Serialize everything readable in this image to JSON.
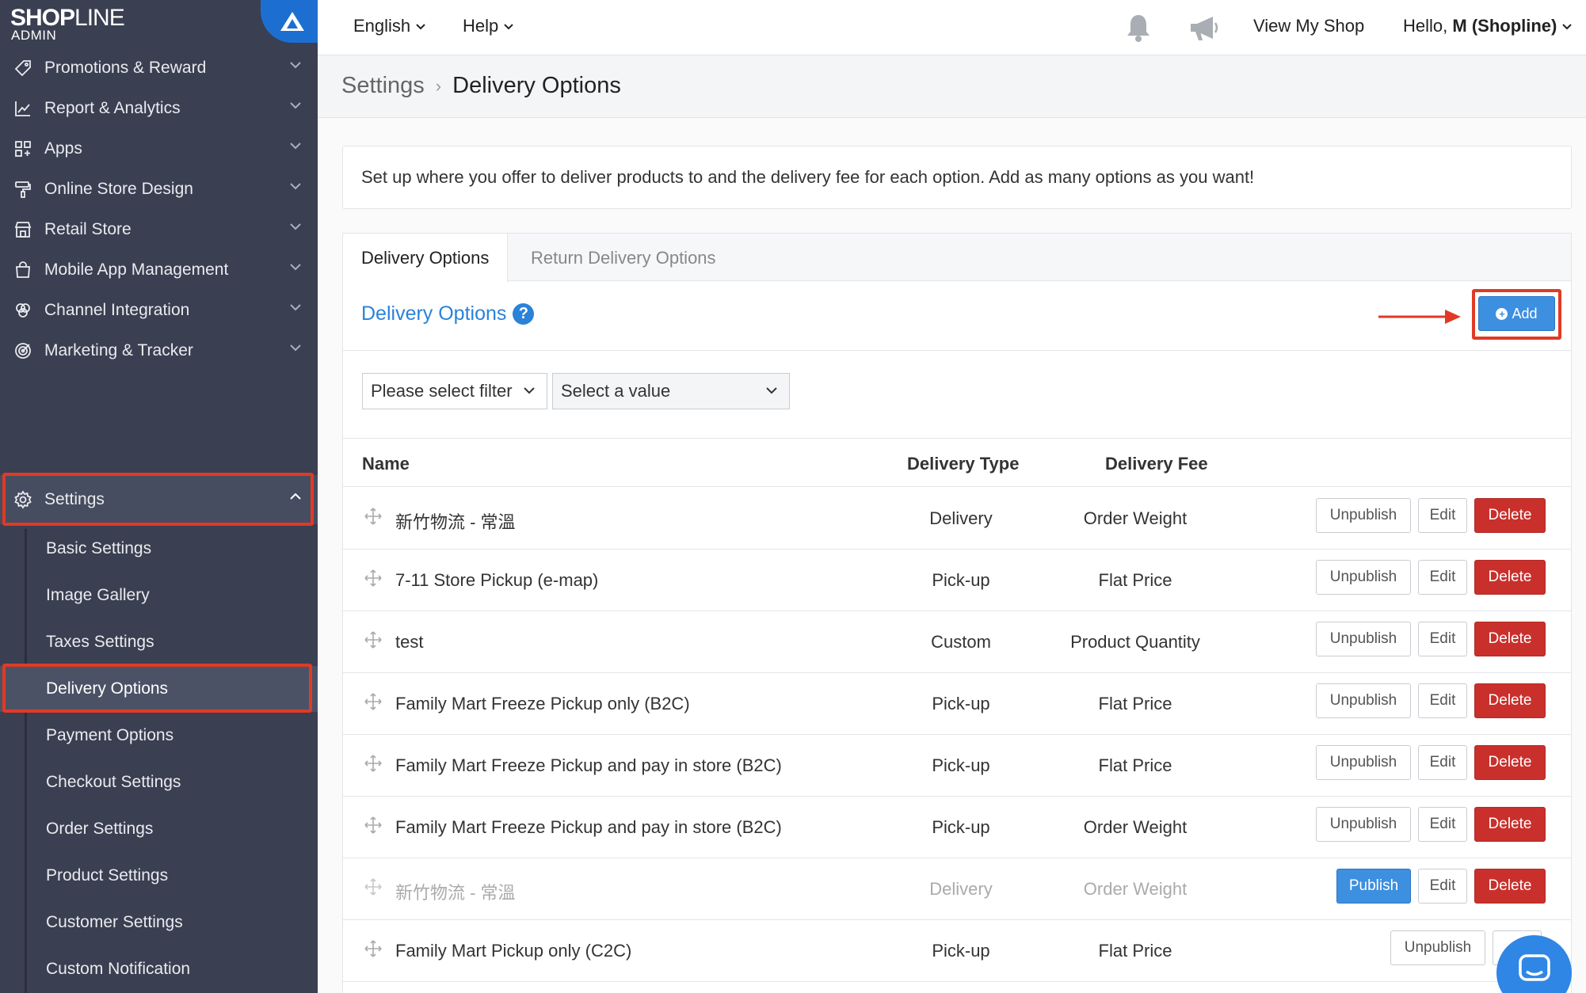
{
  "brand": {
    "logo_main": "SHOP",
    "logo_thin": "LINE",
    "logo_sub": "ADMIN"
  },
  "sidebar": {
    "items": [
      {
        "label": "Promotions & Reward",
        "icon": "tag-icon"
      },
      {
        "label": "Report & Analytics",
        "icon": "chart-icon"
      },
      {
        "label": "Apps",
        "icon": "apps-grid-icon"
      },
      {
        "label": "Online Store Design",
        "icon": "paint-roller-icon"
      },
      {
        "label": "Retail Store",
        "icon": "store-icon"
      },
      {
        "label": "Mobile App Management",
        "icon": "shopping-bag-icon"
      },
      {
        "label": "Channel Integration",
        "icon": "channels-icon"
      },
      {
        "label": "Marketing & Tracker",
        "icon": "target-icon"
      },
      {
        "label": "Settings",
        "icon": "gear-icon",
        "expanded": true
      }
    ],
    "settings_sub": [
      "Basic Settings",
      "Image Gallery",
      "Taxes Settings",
      "Delivery Options",
      "Payment Options",
      "Checkout Settings",
      "Order Settings",
      "Product Settings",
      "Customer Settings",
      "Custom Notification"
    ],
    "active_sub": "Delivery Options"
  },
  "topbar": {
    "language": "English",
    "help": "Help",
    "view_shop": "View My Shop",
    "greeting": "Hello,",
    "user": "M (Shopline)"
  },
  "breadcrumb": {
    "parent": "Settings",
    "current": "Delivery Options"
  },
  "info_text": "Set up where you offer to deliver products to and the delivery fee for each option. Add as many options as you want!",
  "tabs": [
    "Delivery Options",
    "Return Delivery Options"
  ],
  "section": {
    "title": "Delivery Options",
    "help": "?",
    "add_label": "Add"
  },
  "filters": {
    "filter_placeholder": "Please select filter",
    "value_placeholder": "Select a value"
  },
  "table": {
    "headers": {
      "name": "Name",
      "type": "Delivery Type",
      "fee": "Delivery Fee"
    },
    "rows": [
      {
        "name": "新竹物流 - 常溫",
        "type": "Delivery",
        "fee": "Order Weight",
        "toggle": "Unpublish",
        "edit": "Edit",
        "delete": "Delete",
        "published": true
      },
      {
        "name": "7-11 Store Pickup (e-map)",
        "type": "Pick-up",
        "fee": "Flat Price",
        "toggle": "Unpublish",
        "edit": "Edit",
        "delete": "Delete",
        "published": true
      },
      {
        "name": "test",
        "type": "Custom",
        "fee": "Product Quantity",
        "toggle": "Unpublish",
        "edit": "Edit",
        "delete": "Delete",
        "published": true
      },
      {
        "name": "Family Mart Freeze Pickup only (B2C)",
        "type": "Pick-up",
        "fee": "Flat Price",
        "toggle": "Unpublish",
        "edit": "Edit",
        "delete": "Delete",
        "published": true
      },
      {
        "name": "Family Mart Freeze Pickup and pay in store (B2C)",
        "type": "Pick-up",
        "fee": "Flat Price",
        "toggle": "Unpublish",
        "edit": "Edit",
        "delete": "Delete",
        "published": true
      },
      {
        "name": "Family Mart Freeze Pickup and pay in store (B2C)",
        "type": "Pick-up",
        "fee": "Order Weight",
        "toggle": "Unpublish",
        "edit": "Edit",
        "delete": "Delete",
        "published": true
      },
      {
        "name": "新竹物流 - 常溫",
        "type": "Delivery",
        "fee": "Order Weight",
        "toggle": "Publish",
        "edit": "Edit",
        "delete": "Delete",
        "published": false
      },
      {
        "name": "Family Mart Pickup only (C2C)",
        "type": "Pick-up",
        "fee": "Flat Price",
        "toggle": "Unpublish",
        "edit": "",
        "delete": "",
        "published": true
      }
    ]
  },
  "colors": {
    "sidebar_bg": "#3a3f51",
    "accent": "#2a82d9",
    "danger": "#c9302c",
    "highlight": "#e03a25"
  }
}
